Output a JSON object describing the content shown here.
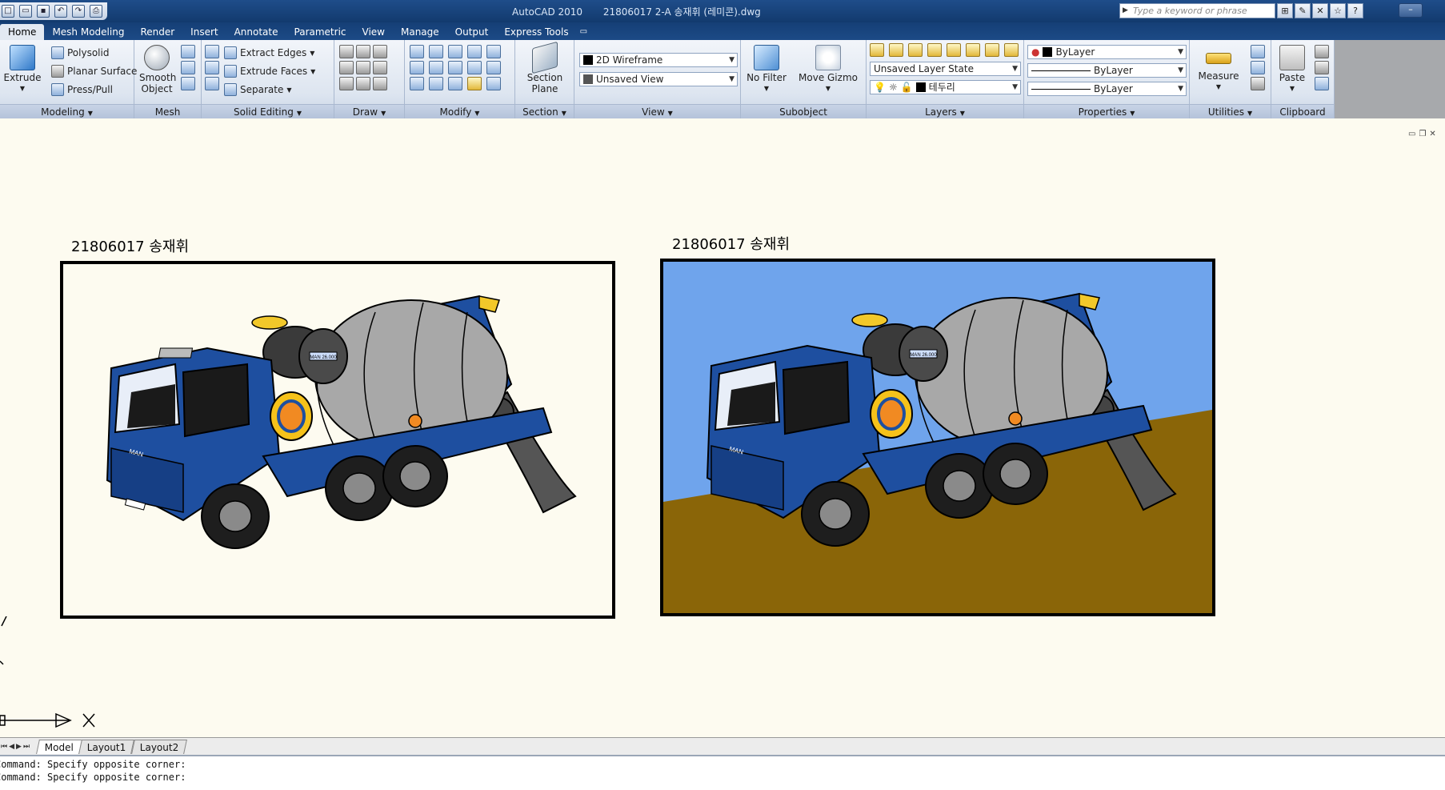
{
  "titlebar": {
    "app": "AutoCAD 2010",
    "document": "21806017 2-A 송재휘 (레미콘).dwg",
    "search_placeholder": "Type a keyword or phrase"
  },
  "tabs": [
    "Home",
    "Mesh Modeling",
    "Render",
    "Insert",
    "Annotate",
    "Parametric",
    "View",
    "Manage",
    "Output",
    "Express Tools"
  ],
  "panels": {
    "modeling": {
      "label": "Modeling",
      "extrude": "Extrude",
      "polysolid": "Polysolid",
      "planar_surface": "Planar Surface",
      "press_pull": "Press/Pull"
    },
    "mesh": {
      "label": "Mesh",
      "smooth_object_1": "Smooth",
      "smooth_object_2": "Object"
    },
    "solid_editing": {
      "label": "Solid Editing",
      "extract_edges": "Extract Edges",
      "extrude_faces": "Extrude Faces",
      "separate": "Separate"
    },
    "draw": {
      "label": "Draw"
    },
    "modify": {
      "label": "Modify"
    },
    "section": {
      "label": "Section",
      "section_plane_1": "Section",
      "section_plane_2": "Plane"
    },
    "view": {
      "label": "View",
      "visual_style": "2D Wireframe",
      "named_view": "Unsaved View"
    },
    "subobject": {
      "label": "Subobject",
      "no_filter": "No Filter",
      "move_gizmo": "Move Gizmo"
    },
    "layers": {
      "label": "Layers",
      "layer_state": "Unsaved Layer State",
      "current_layer": "테두리"
    },
    "properties": {
      "label": "Properties",
      "color": "ByLayer",
      "linetype": "ByLayer",
      "lineweight": "ByLayer"
    },
    "utilities": {
      "label": "Utilities",
      "measure": "Measure"
    },
    "clipboard": {
      "label": "Clipboard",
      "paste": "Paste"
    }
  },
  "drawing": {
    "caption_left": "21806017 송재휘",
    "caption_right": "21806017 송재휘",
    "badge_text": "MAN 26.000",
    "grille_text": "MAN"
  },
  "layout_tabs": [
    "Model",
    "Layout1",
    "Layout2"
  ],
  "command_lines": [
    "Command: Specify opposite corner:",
    "Command: Specify opposite corner:"
  ],
  "colors": {
    "truck_blue": "#1e4fa0",
    "drum_gray": "#a8a8a8",
    "sky_blue": "#6fa4ec",
    "ground_brown": "#8a6508",
    "paper": "#fdfbf0"
  }
}
